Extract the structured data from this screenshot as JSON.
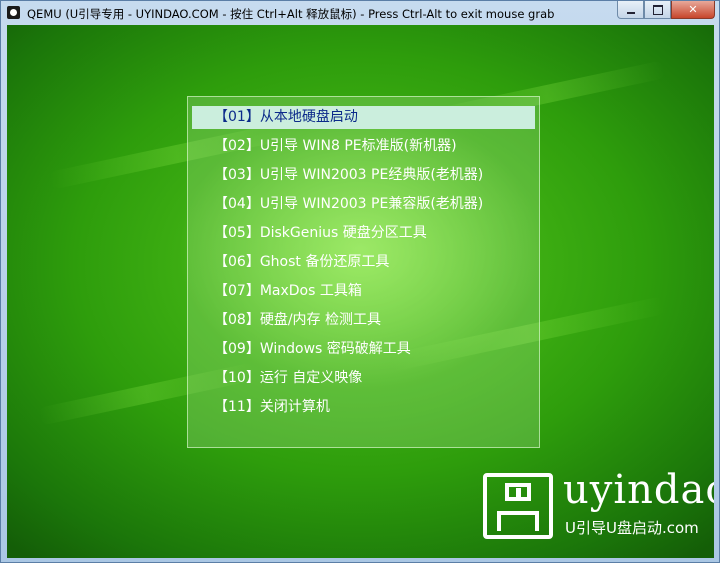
{
  "window": {
    "title": "QEMU (U引导专用 - UYINDAO.COM - 按住 Ctrl+Alt 释放鼠标) - Press Ctrl-Alt to exit mouse grab",
    "icon": "qemu-app-icon",
    "controls": {
      "minimize_icon": "minimize-icon",
      "maximize_icon": "maximize-icon",
      "close_label": "✕"
    }
  },
  "menu": {
    "selected_index": 0,
    "items": [
      {
        "label": "【01】从本地硬盘启动"
      },
      {
        "label": "【02】U引导 WIN8 PE标准版(新机器)"
      },
      {
        "label": "【03】U引导 WIN2003 PE经典版(老机器)"
      },
      {
        "label": "【04】U引导 WIN2003 PE兼容版(老机器)"
      },
      {
        "label": "【05】DiskGenius 硬盘分区工具"
      },
      {
        "label": "【06】Ghost 备份还原工具"
      },
      {
        "label": "【07】MaxDos 工具箱"
      },
      {
        "label": "【08】硬盘/内存 检测工具"
      },
      {
        "label": "【09】Windows 密码破解工具"
      },
      {
        "label": "【10】运行 自定义映像"
      },
      {
        "label": "【11】关闭计算机"
      }
    ]
  },
  "logo": {
    "icon": "usb-drive-logo-icon",
    "word": "uyindao",
    "subtitle": "U引导U盘启动.com"
  },
  "colors": {
    "selected_bg": "#cbeedd",
    "selected_text": "#0b2a8a",
    "menu_text": "#ffffff",
    "background_green": "#2e9d0c"
  }
}
